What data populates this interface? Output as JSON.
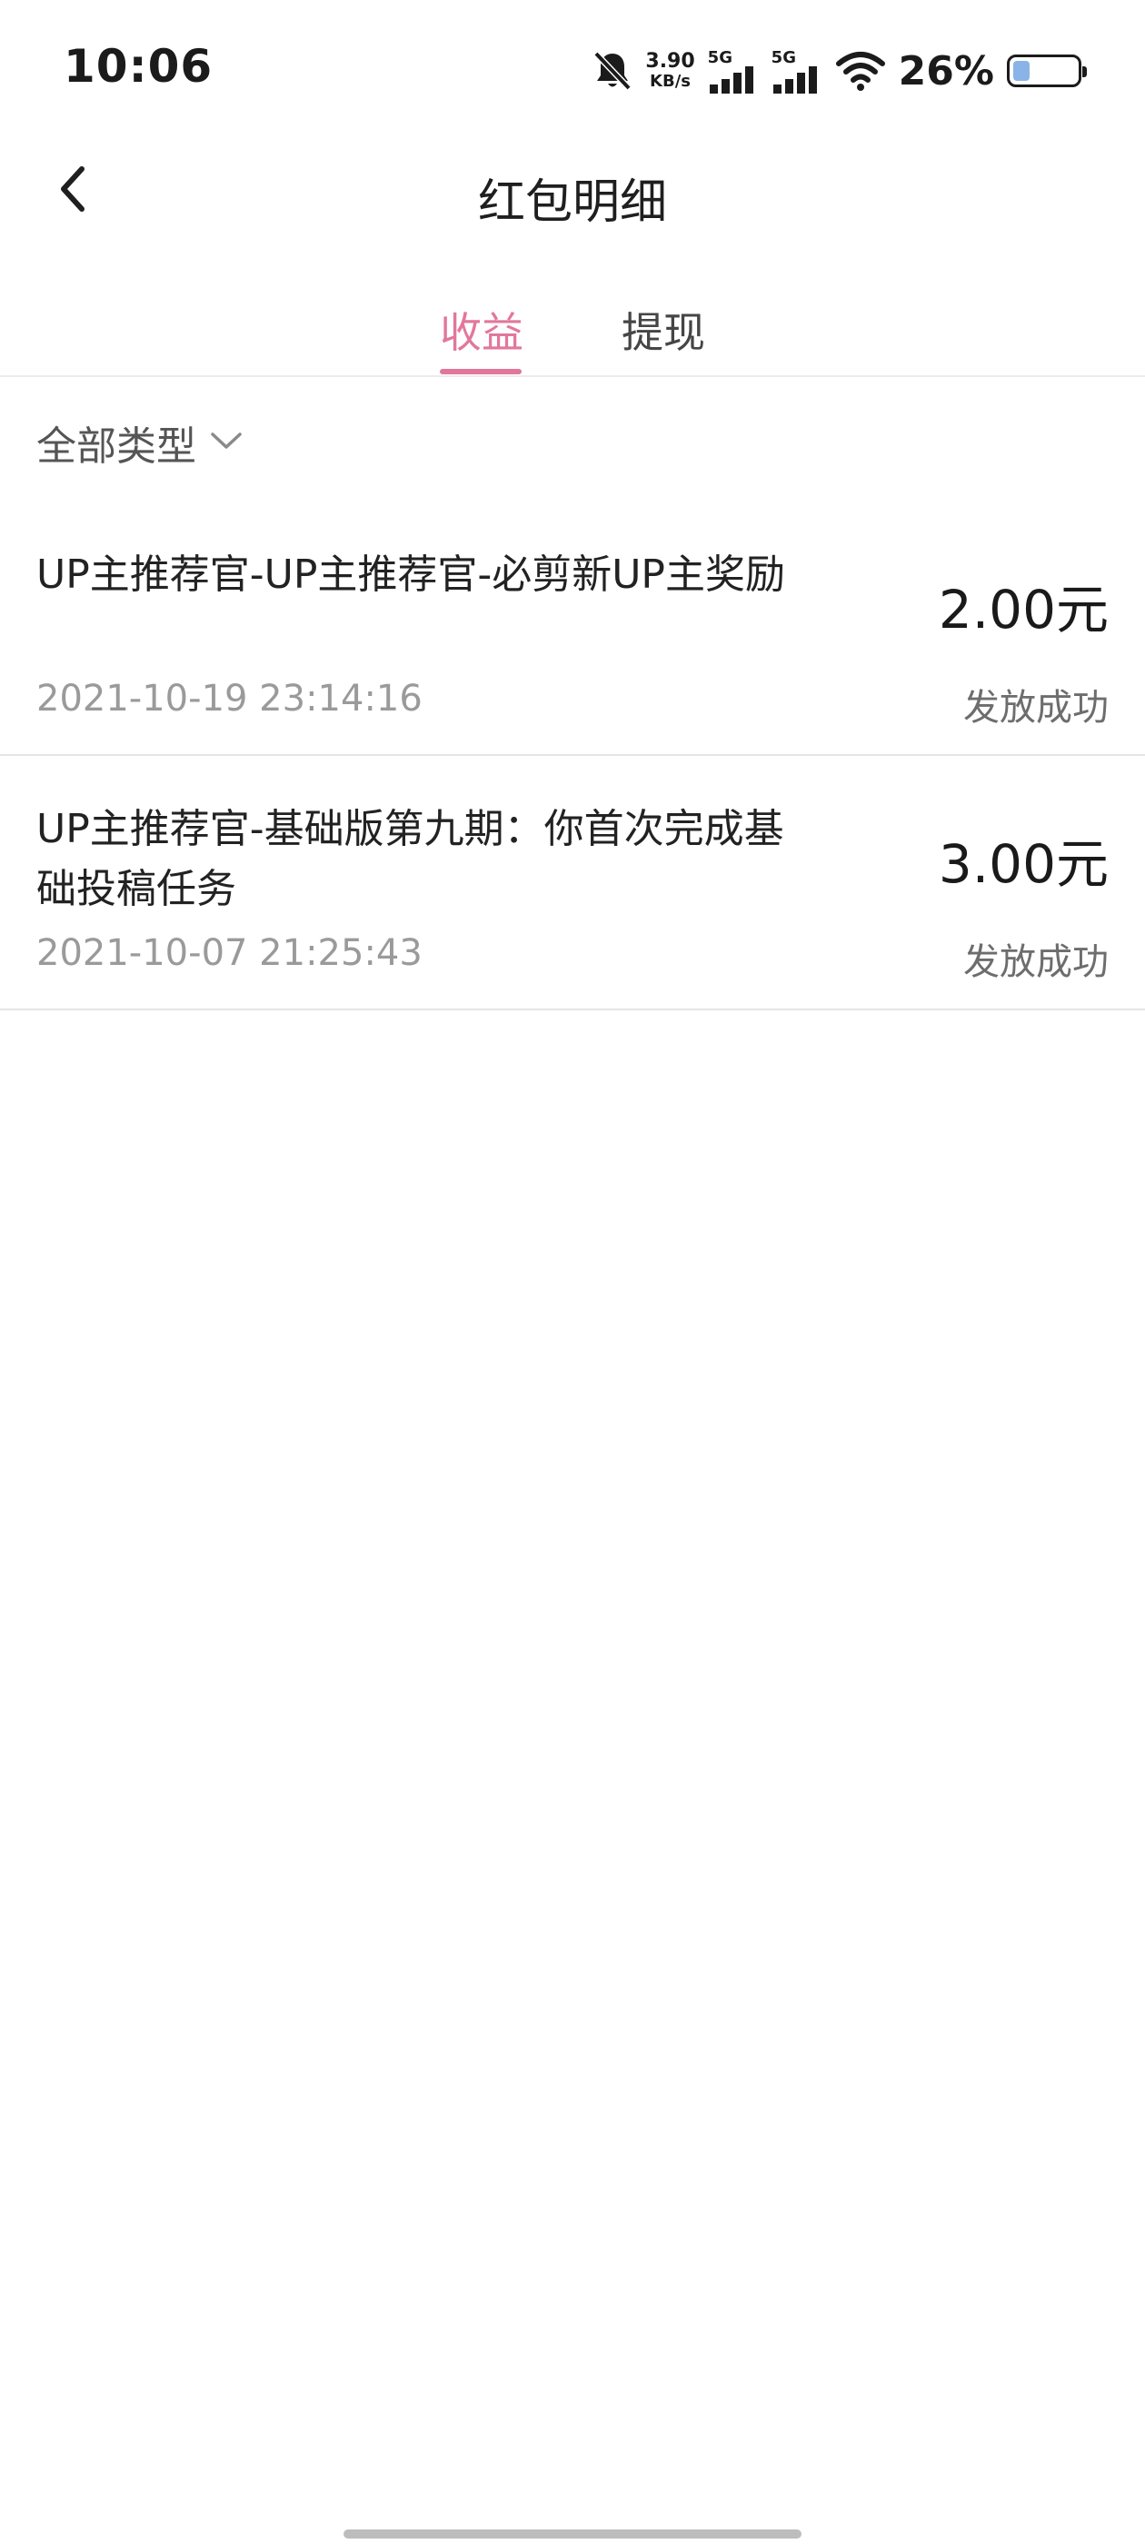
{
  "status_bar": {
    "time": "10:06",
    "net_speed_value": "3.90",
    "net_speed_unit": "KB/s",
    "sim1_label": "5G",
    "sim2_label": "5G",
    "battery_percent": "26%",
    "battery_level": 0.26,
    "icons": [
      "bell-off-icon",
      "signal-icon",
      "signal-icon",
      "wifi-icon",
      "battery-icon"
    ]
  },
  "nav": {
    "title": "红包明细",
    "back_icon": "chevron-left-icon"
  },
  "tabs": [
    {
      "label": "收益",
      "active": true
    },
    {
      "label": "提现",
      "active": false
    }
  ],
  "accent_color": "#e2779c",
  "filter": {
    "label": "全部类型",
    "icon": "chevron-down-icon"
  },
  "records": [
    {
      "title": "UP主推荐官-UP主推荐官-必剪新UP主奖励",
      "time": "2021-10-19 23:14:16",
      "amount": "2.00元",
      "status": "发放成功"
    },
    {
      "title": "UP主推荐官-基础版第九期：你首次完成基础投稿任务",
      "time": "2021-10-07 21:25:43",
      "amount": "3.00元",
      "status": "发放成功"
    }
  ]
}
